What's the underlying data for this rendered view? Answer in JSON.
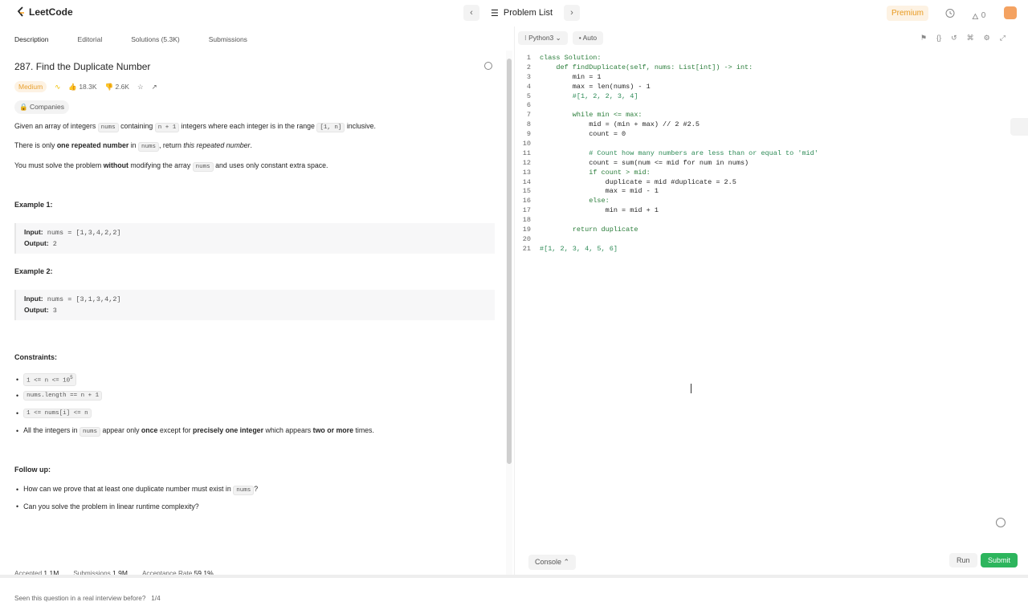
{
  "app": {
    "name": "LeetCode"
  },
  "nav": {
    "problem_list": "Problem List",
    "premium": "Premium",
    "streak": "0"
  },
  "tabs": [
    "Description",
    "Editorial",
    "Solutions (5.3K)",
    "Submissions"
  ],
  "problem": {
    "title": "287. Find the Duplicate Number",
    "difficulty": "Medium",
    "likes": "18.3K",
    "dislikes": "2.6K",
    "companies": "Companies",
    "para1": [
      "Given an array of integers ",
      "nums",
      " containing ",
      "n + 1",
      " integers where each integer is in the range ",
      "[1, n]",
      " inclusive."
    ],
    "para2": [
      "There is only ",
      "one repeated number",
      " in ",
      "nums",
      ", return ",
      "this repeated number",
      "."
    ],
    "para3": [
      "You must solve the problem ",
      "without",
      " modifying the array ",
      "nums",
      " and uses only constant extra space."
    ],
    "examples": [
      {
        "title": "Example 1:",
        "input_label": "Input:",
        "input": "nums = [1,3,4,2,2]",
        "output_label": "Output:",
        "output": "2"
      },
      {
        "title": "Example 2:",
        "input_label": "Input:",
        "input": "nums = [3,1,3,4,2]",
        "output_label": "Output:",
        "output": "3"
      }
    ],
    "constraints_title": "Constraints:",
    "constraints": [
      "1 <= n <= 10",
      "nums.length == n + 1",
      "1 <= nums[i] <= n"
    ],
    "constraint_last": [
      "All the integers in ",
      "nums",
      " appear only ",
      "once",
      " except for ",
      "precisely one integer",
      " which appears ",
      "two or more",
      " times."
    ],
    "followup_title": "Follow up:",
    "followups": [
      [
        "How can we prove that at least one duplicate number must exist in ",
        "nums",
        "?"
      ],
      [
        "Can you solve the problem in linear runtime complexity?"
      ]
    ],
    "stats": {
      "accepted_label": "Accepted",
      "accepted": "1.1M",
      "submissions_label": "Submissions",
      "submissions": "1.9M",
      "rate_label": "Acceptance Rate",
      "rate": "59.1%"
    },
    "seen": "Seen this question in a real interview before?",
    "seen_count": "1/4"
  },
  "editor": {
    "language": "Python3",
    "mode": "Auto",
    "code": [
      "class Solution:",
      "    def findDuplicate(self, nums: List[int]) -> int:",
      "        min = 1",
      "        max = len(nums) - 1",
      "        #[1, 2, 2, 3, 4]",
      "",
      "        while min <= max:",
      "            mid = (min + max) // 2 #2.5",
      "            count = 0",
      "",
      "            # Count how many numbers are less than or equal to 'mid'",
      "            count = sum(num <= mid for num in nums)",
      "            if count > mid:",
      "                duplicate = mid #duplicate = 2.5",
      "                max = mid - 1",
      "            else:",
      "                min = mid + 1",
      "",
      "        return duplicate",
      "",
      "#[1, 2, 3, 4, 5, 6]"
    ],
    "console": "Console",
    "run": "Run",
    "submit": "Submit"
  }
}
